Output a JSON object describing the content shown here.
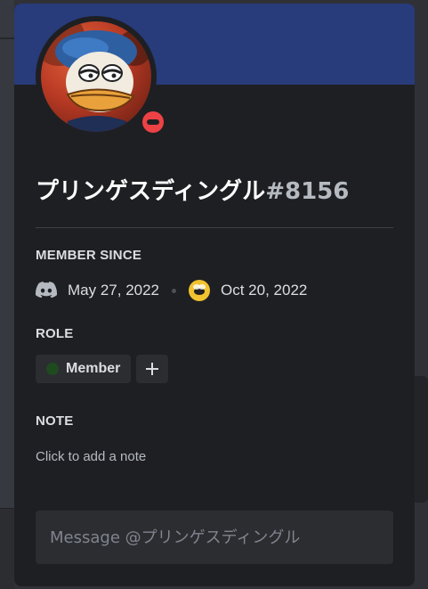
{
  "profile": {
    "username": "プリンゲスディングル",
    "discriminator": "#8156",
    "status": "do-not-disturb"
  },
  "sections": {
    "member_since_title": "MEMBER SINCE",
    "discord_joined": "May 27, 2022",
    "server_joined": "Oct 20, 2022",
    "role_title": "ROLE",
    "note_title": "NOTE",
    "note_placeholder": "Click to add a note"
  },
  "roles": [
    {
      "name": "Member",
      "color": "#1f4a1f"
    }
  ],
  "message": {
    "placeholder": "Message @プリンゲスディングル"
  },
  "colors": {
    "banner": "#283b7b",
    "card": "#1e1f22",
    "status_dnd": "#ed4245"
  }
}
